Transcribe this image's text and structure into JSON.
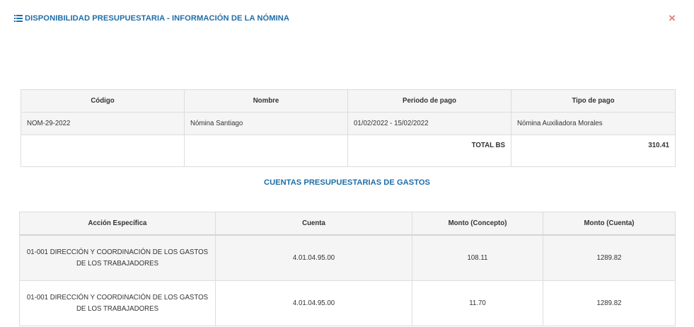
{
  "modal": {
    "title": "DISPONIBILIDAD PRESUPUESTARIA - INFORMACIÓN DE LA NÓMINA",
    "close_label": "×",
    "title_icon": "list-icon",
    "accent_color": "#1f6ea8",
    "close_color": "#e47f7f"
  },
  "nomina": {
    "headers": [
      "Código",
      "Nombre",
      "Periodo de pago",
      "Tipo de pago"
    ],
    "row": {
      "codigo": "NOM-29-2022",
      "nombre": "Nómina Santiago",
      "periodo": "01/02/2022 - 15/02/2022",
      "tipo": "Nómina Auxiliadora Morales"
    },
    "total_label": "TOTAL BS",
    "total_value": "310.41"
  },
  "cuentas": {
    "title": "CUENTAS PRESUPUESTARIAS DE GASTOS",
    "headers": [
      "Acción Específica",
      "Cuenta",
      "Monto (Concepto)",
      "Monto (Cuenta)"
    ],
    "rows": [
      {
        "accion": "01-001 DIRECCIÓN Y COORDINACIÓN DE LOS GASTOS DE LOS TRABAJADORES",
        "cuenta": "4.01.04.95.00",
        "monto_concepto": "108.11",
        "monto_cuenta": "1289.82"
      },
      {
        "accion": "01-001 DIRECCIÓN Y COORDINACIÓN DE LOS GASTOS DE LOS TRABAJADORES",
        "cuenta": "4.01.04.95.00",
        "monto_concepto": "11.70",
        "monto_cuenta": "1289.82"
      }
    ]
  }
}
